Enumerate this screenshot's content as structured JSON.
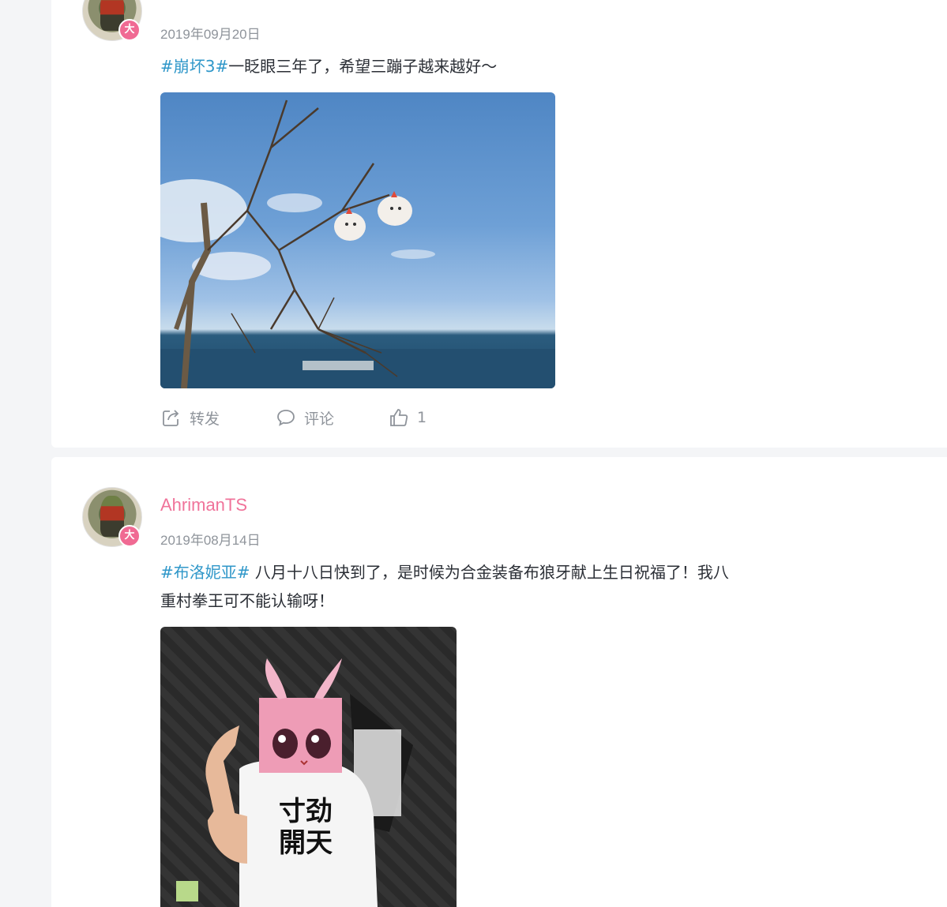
{
  "posts": [
    {
      "date": "2019年09月20日",
      "tag": "#崩坏3#",
      "text": "一眨眼三年了，希望三蹦子越来越好～",
      "actions": {
        "repost_label": "转发",
        "comment_label": "评论",
        "like_count": "1"
      }
    },
    {
      "username": "AhrimanTS",
      "date": "2019年08月14日",
      "tag": "#布洛妮亚#",
      "text_line1": " 八月十八日快到了，是时候为合金装备布狼牙献上生日祝福了！我八",
      "text_line2": "重村拳王可不能认输呀！"
    }
  ],
  "badge_label": "大",
  "colors": {
    "accent_blue": "#2f97c9",
    "username_pink": "#f0739a",
    "meta_gray": "#8f949b"
  }
}
